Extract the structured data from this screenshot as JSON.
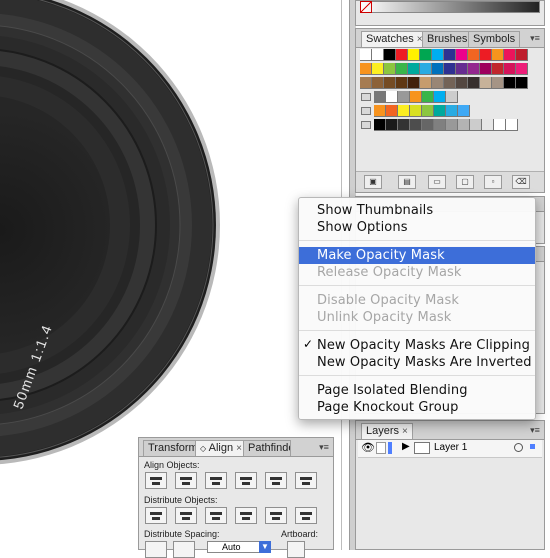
{
  "colors": {
    "lens_dark": "#2b2b2b",
    "lens_mid": "#3c3c3c",
    "menu_highlight": "#3d6ed9",
    "panel_bg": "#e8e8e8"
  },
  "lens": {
    "engraving": "50mm 1:1.4"
  },
  "swatches_panel": {
    "tabs": [
      "Swatches",
      "Brushes",
      "Symbols"
    ],
    "close_glyph": "×",
    "menu_glyph": "▾≡"
  },
  "context_menu": {
    "items": [
      {
        "label": "Show Thumbnails",
        "state": "normal"
      },
      {
        "label": "Show Options",
        "state": "normal"
      },
      {
        "label": "Make Opacity Mask",
        "state": "highlighted"
      },
      {
        "label": "Release Opacity Mask",
        "state": "disabled"
      },
      {
        "label": "Disable Opacity Mask",
        "state": "disabled"
      },
      {
        "label": "Unlink Opacity Mask",
        "state": "disabled"
      },
      {
        "label": "New Opacity Masks Are Clipping",
        "state": "checked"
      },
      {
        "label": "New Opacity Masks Are Inverted",
        "state": "normal"
      },
      {
        "label": "Page Isolated Blending",
        "state": "normal"
      },
      {
        "label": "Page Knockout Group",
        "state": "normal"
      }
    ],
    "check_glyph": "✓"
  },
  "layers_panel": {
    "tab": "Layers",
    "layer_name": "Layer 1"
  },
  "align_panel": {
    "tabs": [
      "Transform",
      "Align",
      "Pathfinder"
    ],
    "align_objects_label": "Align Objects:",
    "distribute_objects_label": "Distribute Objects:",
    "distribute_spacing_label": "Distribute Spacing:",
    "artboard_label": "Artboard:",
    "spacing_value": "Auto"
  }
}
